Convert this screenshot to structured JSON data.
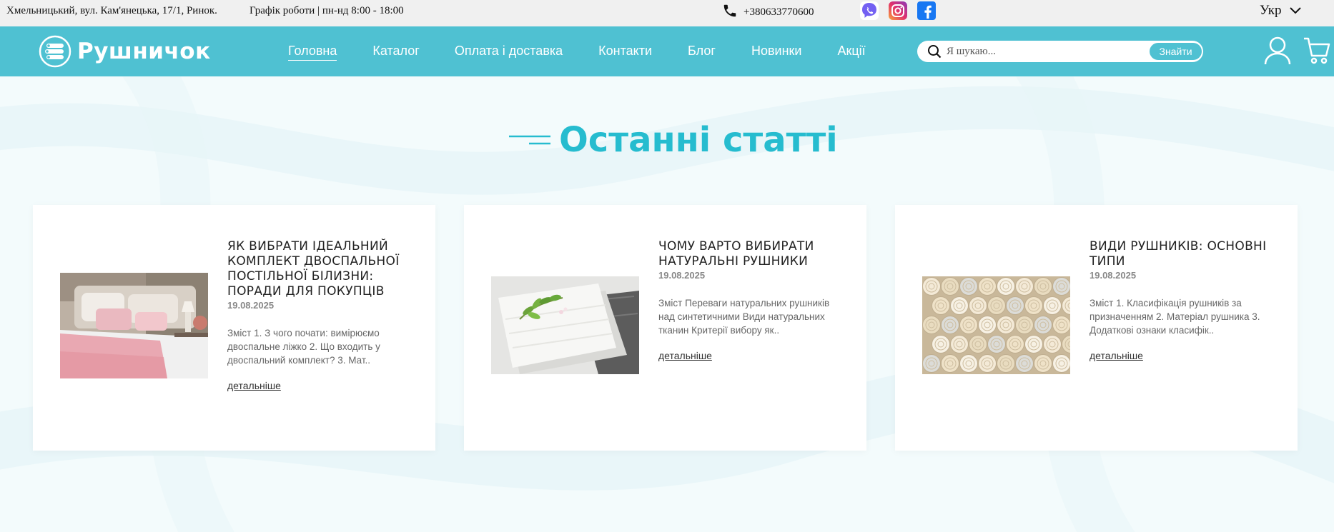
{
  "topbar": {
    "address": "Хмельницький, вул. Кам'янецька, 17/1, Ринок.",
    "hours": "Графік роботи | пн-нд 8:00 - 18:00",
    "phone": "+380633770600",
    "language": "Укр"
  },
  "header": {
    "logo_text": "Рушничок",
    "nav": [
      {
        "label": "Головна"
      },
      {
        "label": "Каталог"
      },
      {
        "label": "Оплата і доставка"
      },
      {
        "label": "Контакти"
      },
      {
        "label": "Блог"
      },
      {
        "label": "Новинки"
      },
      {
        "label": "Акції"
      }
    ],
    "search": {
      "placeholder": "Я шукаю...",
      "button": "Знайти"
    }
  },
  "section": {
    "title": "Останні статті"
  },
  "articles": [
    {
      "title": "ЯК ВИБРАТИ ІДЕАЛЬНИЙ КОМПЛЕКТ ДВОСПАЛЬНОЇ ПОСТІЛЬНОЇ БІЛИЗНИ: ПОРАДИ ДЛЯ ПОКУПЦІВ",
      "date": "19.08.2025",
      "excerpt": "Зміст 1. З чого почати: вимірюємо двоспальне ліжко 2. Що входить у двоспальний комплект? 3. Мат..",
      "more": "детальніше"
    },
    {
      "title": "ЧОМУ ВАРТО ВИБИРАТИ НАТУРАЛЬНІ РУШНИКИ",
      "date": "19.08.2025",
      "excerpt": "Зміст Переваги натуральних рушників над синтетичними Види натуральних тканин Критерії вибору як..",
      "more": "детальніше"
    },
    {
      "title": "ВИДИ РУШНИКІВ: ОСНОВНІ ТИПИ",
      "date": "19.08.2025",
      "excerpt": "Зміст 1. Класифікація рушників за призначенням 2. Матеріал рушника 3. Додаткові ознаки класифік..",
      "more": "детальніше"
    }
  ],
  "colors": {
    "brand": "#4fc1d2",
    "title": "#26bccf"
  }
}
